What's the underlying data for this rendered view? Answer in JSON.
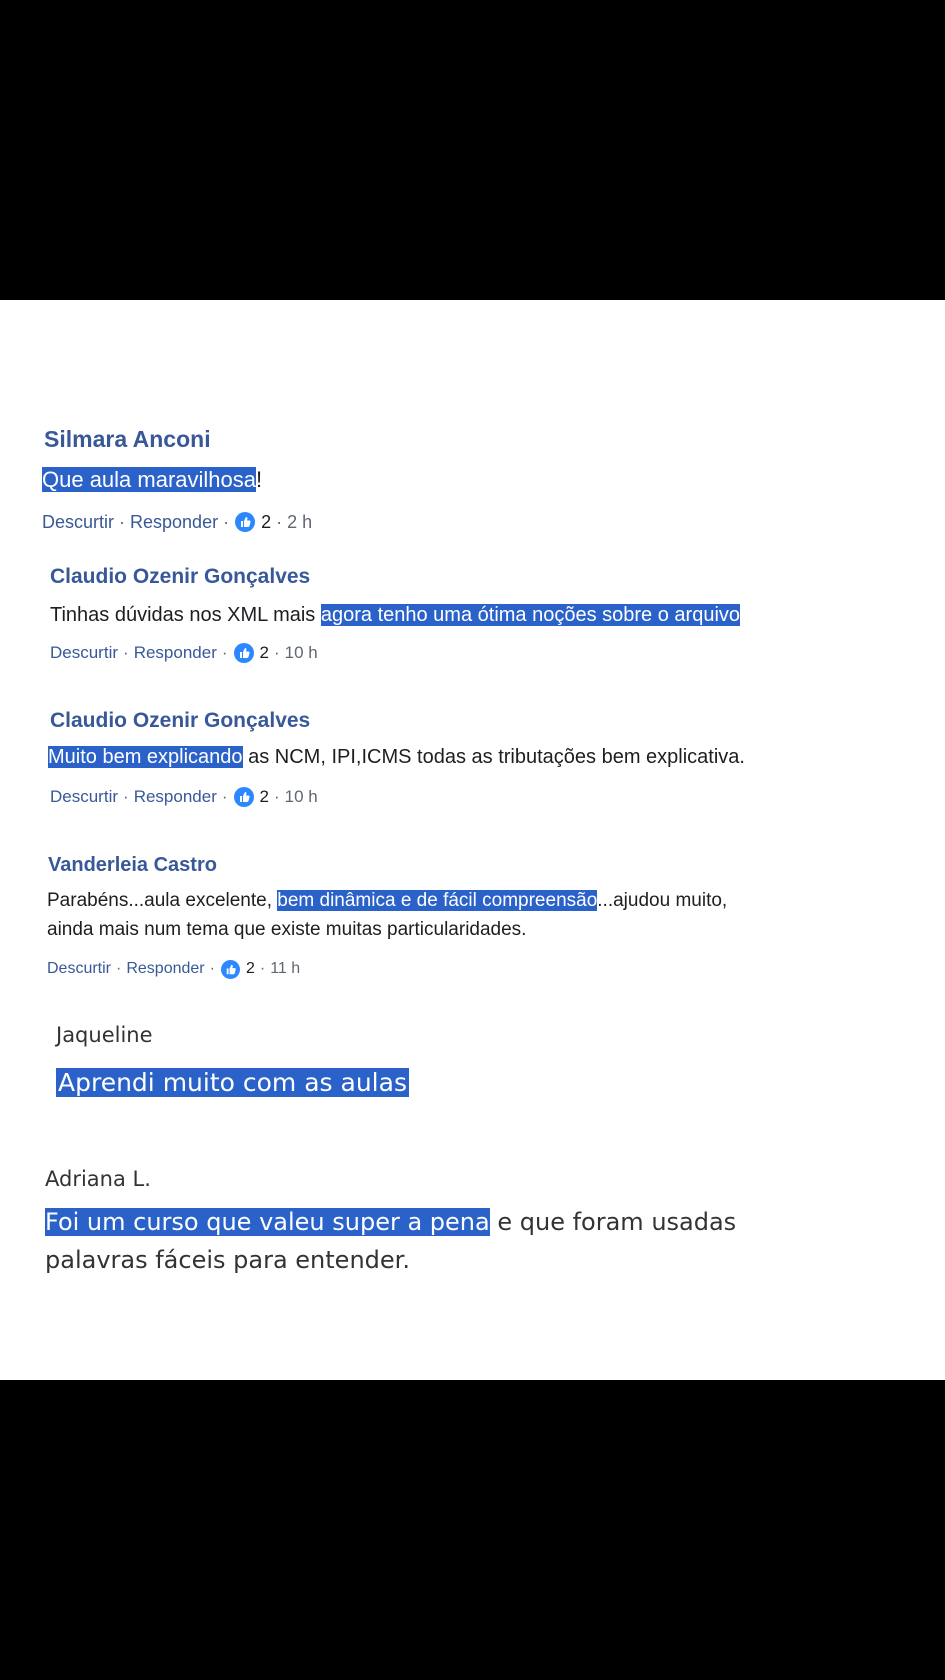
{
  "comments": [
    {
      "name": "Silmara Anconi",
      "highlight": "Que aula maravilhosa",
      "after": "!",
      "unlike": "Descurtir",
      "reply": "Responder",
      "sep": "·",
      "likes": "2",
      "time": "2 h"
    },
    {
      "name": "Claudio Ozenir Gonçalves",
      "before": "Tinhas dúvidas nos XML mais ",
      "highlight": "agora tenho uma ótima noções sobre o arquivo",
      "unlike": "Descurtir",
      "reply": "Responder",
      "sep": "·",
      "likes": "2",
      "time": "10 h"
    },
    {
      "name": "Claudio Ozenir Gonçalves",
      "highlight": "Muito bem explicando",
      "after": " as NCM, IPI,ICMS todas as tributações bem explicativa.",
      "unlike": "Descurtir",
      "reply": "Responder",
      "sep": "·",
      "likes": "2",
      "time": "10 h"
    },
    {
      "name": "Vanderleia Castro",
      "before": "Parabéns...aula excelente, ",
      "highlight": "bem dinâmica e de fácil compreensão",
      "after": "...ajudou muito,",
      "line2": "ainda mais num tema que existe muitas particularidades.",
      "unlike": "Descurtir",
      "reply": "Responder",
      "sep": "·",
      "likes": "2",
      "time": "11 h"
    }
  ],
  "reviews": [
    {
      "name": "Jaqueline",
      "highlight": "Aprendi muito com as aulas"
    },
    {
      "name": "Adriana L.",
      "highlight": "Foi um curso que valeu super a pena",
      "after": " e que foram usadas",
      "line2": "palavras fáceis para entender."
    }
  ],
  "colors": {
    "highlight": "#2a62c9",
    "name": "#385898",
    "like_icon": "#2d88ff"
  },
  "icons": {
    "like": "thumbs-up-icon"
  }
}
